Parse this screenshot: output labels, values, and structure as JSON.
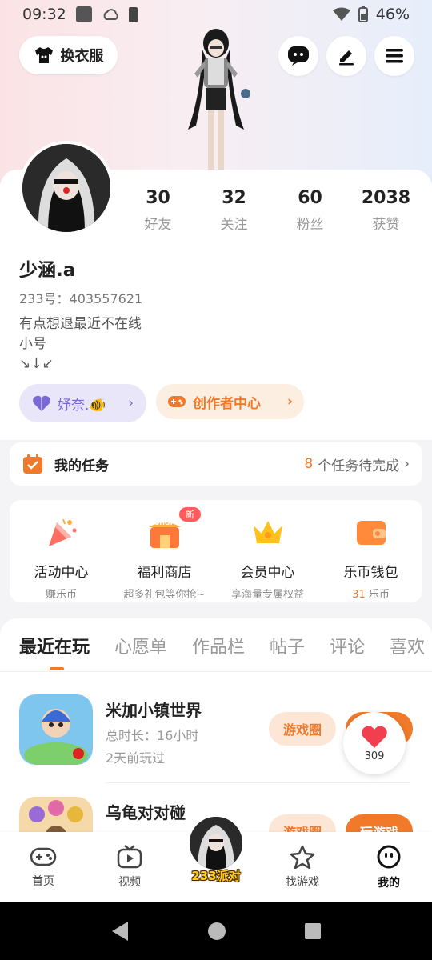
{
  "status_bar": {
    "time": "09:32",
    "battery": "46%"
  },
  "top": {
    "outfit_label": "换衣服"
  },
  "profile": {
    "stats": [
      {
        "num": "30",
        "label": "好友"
      },
      {
        "num": "32",
        "label": "关注"
      },
      {
        "num": "60",
        "label": "粉丝"
      },
      {
        "num": "2038",
        "label": "获赞"
      }
    ],
    "nickname": "少涵.a",
    "uid": "233号：403557621",
    "bio": [
      "有点想退最近不在线",
      "小号",
      "↘↓↙"
    ],
    "friend_chip": "妤奈.🐠",
    "creator_chip": "创作者中心"
  },
  "tasks": {
    "title": "我的任务",
    "count": "8",
    "suffix": "个任务待完成"
  },
  "features": [
    {
      "title": "活动中心",
      "sub": "赚乐币"
    },
    {
      "title": "福利商店",
      "sub": "超多礼包等你抢~",
      "badge": "新",
      "icon_text": "SHOP"
    },
    {
      "title": "会员中心",
      "sub": "享海量专属权益"
    },
    {
      "title": "乐币钱包",
      "coins": "31",
      "sub_suffix": "乐币"
    }
  ],
  "tabs": [
    "最近在玩",
    "心愿单",
    "作品栏",
    "帖子",
    "评论",
    "喜欢"
  ],
  "games": [
    {
      "title": "米加小镇世界",
      "duration": "总时长：16小时",
      "last_played": "2天前玩过",
      "circle_btn": "游戏圈"
    },
    {
      "title": "乌龟对对碰",
      "duration": "",
      "last_played": "",
      "circle_btn": "游戏圈",
      "play_btn": "玩游戏"
    }
  ],
  "like": {
    "count": "309"
  },
  "bottom_nav": [
    {
      "label": "首页"
    },
    {
      "label": "视频"
    },
    {
      "label": "233派对"
    },
    {
      "label": "找游戏"
    },
    {
      "label": "我的"
    }
  ],
  "colors": {
    "accent": "#f07a2a",
    "purple": "#7a68d6"
  }
}
